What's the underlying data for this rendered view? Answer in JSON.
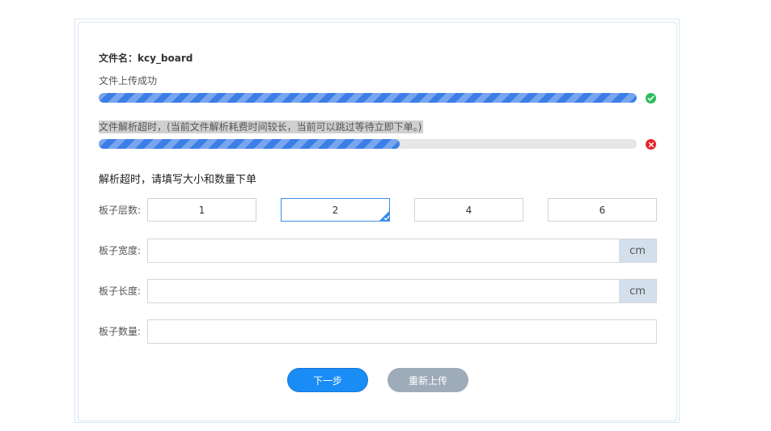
{
  "file": {
    "label": "文件名：",
    "name": "kcy_board"
  },
  "upload": {
    "status_text": "文件上传成功",
    "progress": 1.0,
    "status_icon": "check-circle-icon",
    "status_color": "#2dbd5d"
  },
  "parse": {
    "status_text": "文件解析超时，(当前文件解析耗费时间较长，当前可以跳过等待立即下单。)",
    "progress": 0.56,
    "status_icon": "close-circle-icon",
    "status_color": "#e8232a"
  },
  "form": {
    "title": "解析超时，请填写大小和数量下单",
    "layers": {
      "label": "板子层数:",
      "options": [
        "1",
        "2",
        "4",
        "6"
      ],
      "selected": "2"
    },
    "width": {
      "label": "板子宽度:",
      "value": "",
      "unit": "cm"
    },
    "length": {
      "label": "板子长度:",
      "value": "",
      "unit": "cm"
    },
    "quantity": {
      "label": "板子数量:",
      "value": ""
    }
  },
  "actions": {
    "next_label": "下一步",
    "reupload_label": "重新上传"
  },
  "colors": {
    "accent": "#1a8cf5",
    "progress": "#3c7ee6",
    "unit_bg": "#d3dfeb"
  }
}
